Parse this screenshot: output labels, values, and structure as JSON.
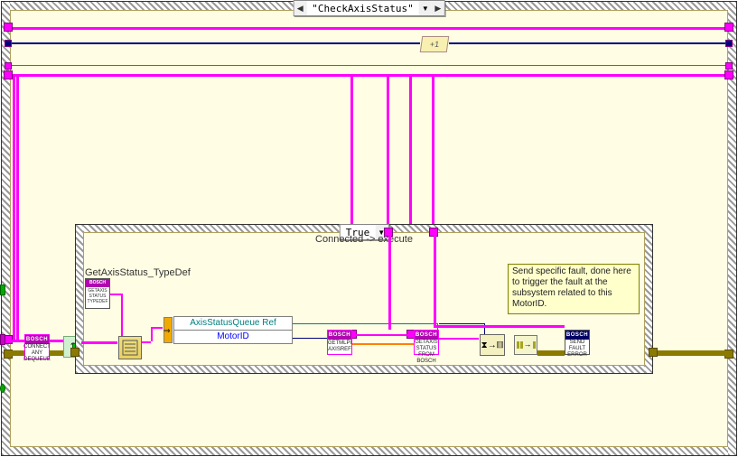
{
  "outer_case": {
    "selector_label": "\"CheckAxisStatus\""
  },
  "inner_case": {
    "selector_label": "True",
    "caption": "Connected -> execute"
  },
  "increment_node": {
    "label": "+1"
  },
  "typedef": {
    "label": "GetAxisStatus_TypeDef",
    "icon_header": "BOSCH",
    "icon_text": "GETAXIS STATUS TYPEDEF"
  },
  "unbundle": {
    "row1": "AxisStatusQueue Ref",
    "row2": "MotorID"
  },
  "subvis": {
    "connect_dequeue": {
      "header": "BOSCH",
      "body": "CONNECT ANY DEQUEUE"
    },
    "getmlpi": {
      "header": "BOSCH",
      "body": "GETMLPI AXISREF"
    },
    "getaxis_from": {
      "header": "BOSCH",
      "body": "GETAXIS STATUS FROM BOSCH"
    },
    "send_fault": {
      "header": "BOSCH",
      "body": "SEND FAULT ERROR"
    }
  },
  "comment": {
    "text": "Send specific fault, done here to trigger the fault at the subsystem related to this MotorID."
  },
  "merge_errors": {
    "tooltip": "Merge Errors"
  },
  "unbundle_prim": {
    "name": "Unbundle By Name"
  }
}
